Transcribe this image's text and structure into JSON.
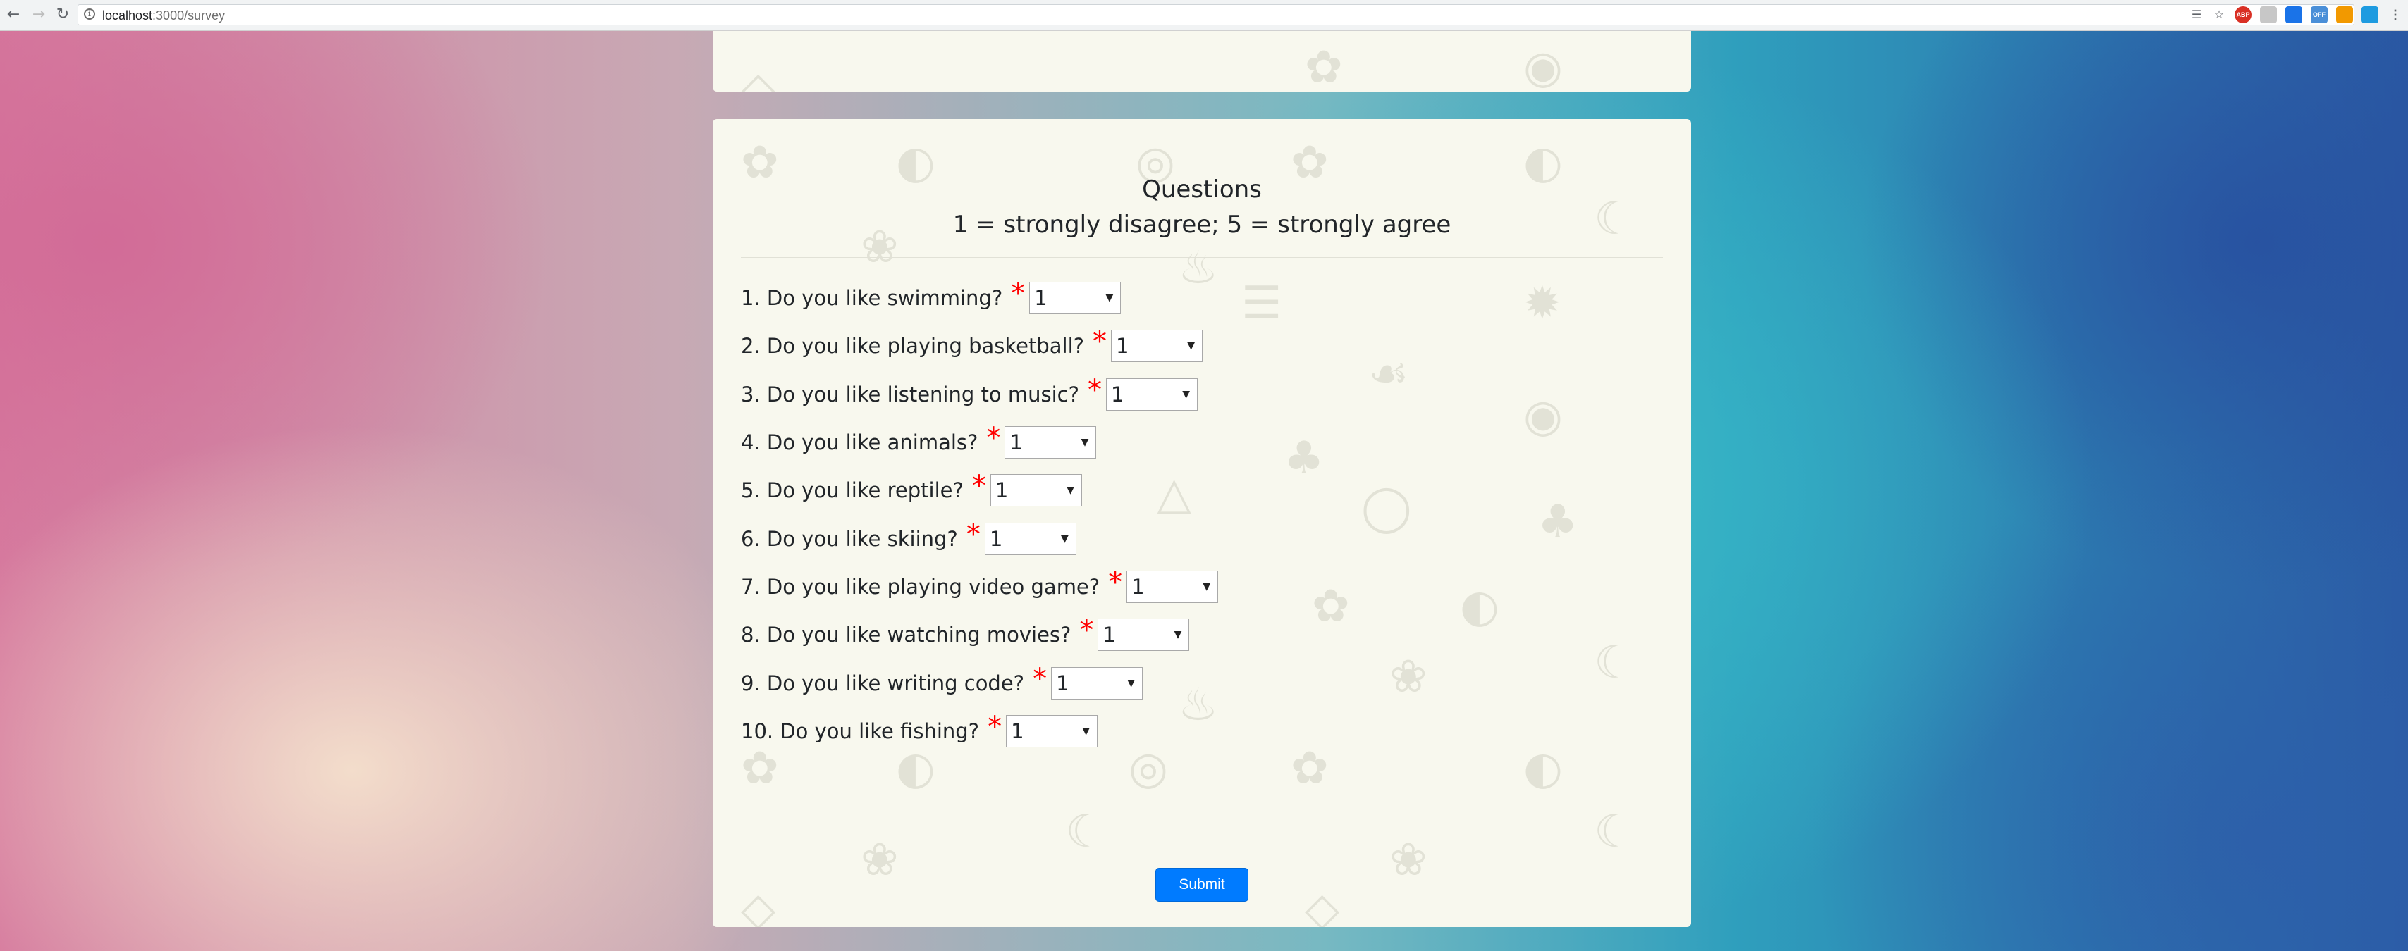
{
  "browser": {
    "url_host": "localhost",
    "url_path": ":3000/survey",
    "ext_abp": "ABP",
    "ext_off": "OFF"
  },
  "survey": {
    "title": "Questions",
    "subtitle": "1 = strongly disagree; 5 = strongly agree",
    "required_mark": "*",
    "questions": [
      {
        "label": "1. Do you like swimming?",
        "value": "1"
      },
      {
        "label": "2. Do you like playing basketball?",
        "value": "1"
      },
      {
        "label": "3. Do you like listening to music?",
        "value": "1"
      },
      {
        "label": "4. Do you like animals?",
        "value": "1"
      },
      {
        "label": "5. Do you like reptile?",
        "value": "1"
      },
      {
        "label": "6. Do you like skiing?",
        "value": "1"
      },
      {
        "label": "7. Do you like playing video game?",
        "value": "1"
      },
      {
        "label": "8. Do you like watching movies?",
        "value": "1"
      },
      {
        "label": "9. Do you like writing code?",
        "value": "1"
      },
      {
        "label": "10. Do you like fishing?",
        "value": "1"
      }
    ],
    "submit_label": "Submit"
  },
  "colors": {
    "card_background": "#f8f8ee",
    "required": "#ff0000",
    "submit_background": "#007bff"
  },
  "icons": [
    "back-icon",
    "forward-icon",
    "reload-icon",
    "info-icon",
    "translate-icon",
    "star-icon",
    "extension-icons",
    "menu-icon"
  ]
}
